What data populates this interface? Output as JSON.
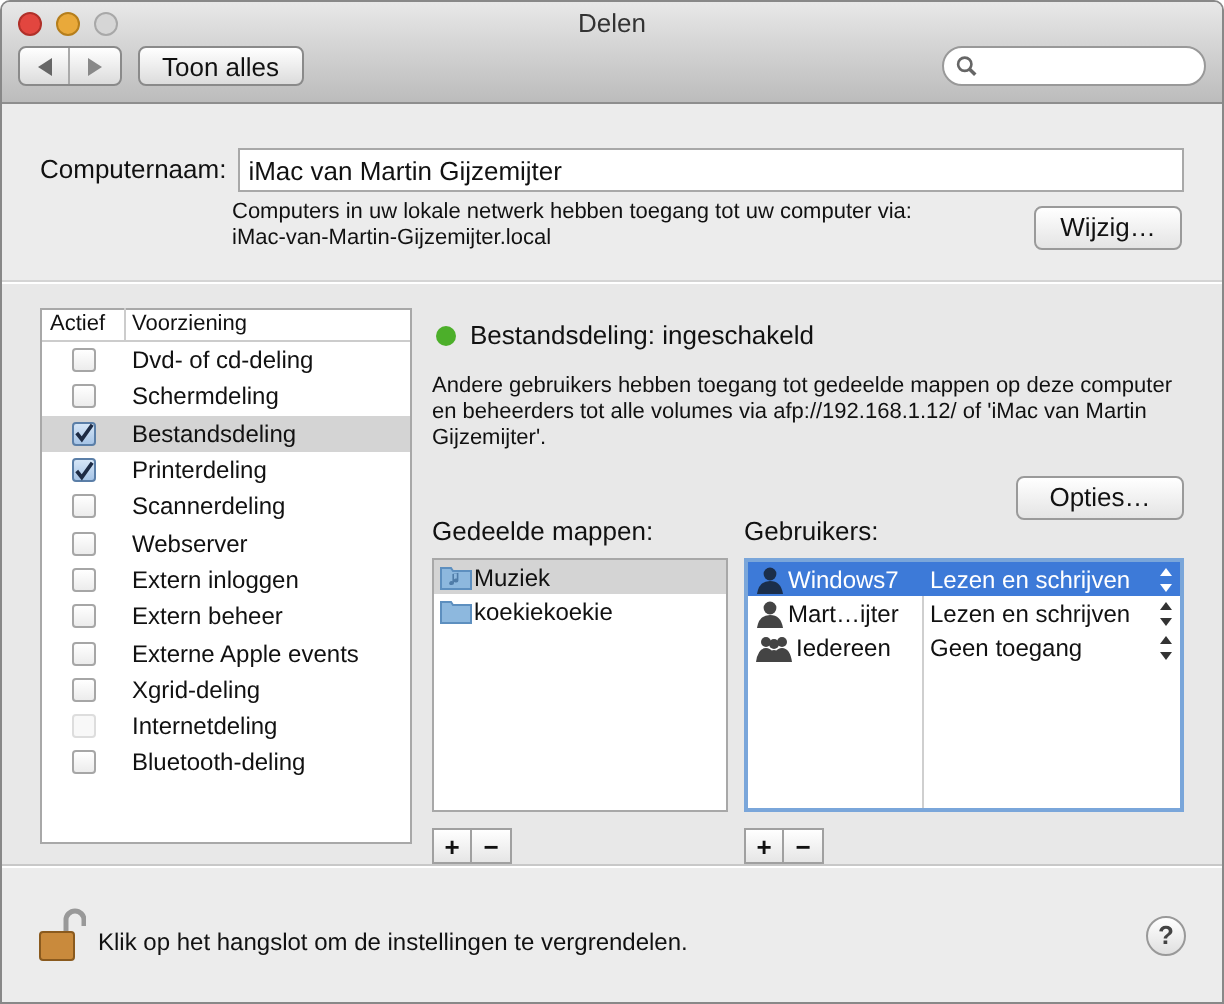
{
  "window": {
    "title": "Delen"
  },
  "toolbar": {
    "show_all": "Toon alles"
  },
  "computer_name": {
    "label": "Computernaam:",
    "value": "iMac van Martin Gijzemijter",
    "info": "Computers in uw lokale netwerk hebben toegang tot uw computer via:",
    "address": "iMac-van-Martin-Gijzemijter.local",
    "button": "Wijzig…"
  },
  "services": {
    "columns": [
      "Actief",
      "Voorziening"
    ],
    "items": [
      {
        "name": "Dvd- of cd-deling",
        "checked": false,
        "disabled": false,
        "selected": false
      },
      {
        "name": "Schermdeling",
        "checked": false,
        "disabled": false,
        "selected": false
      },
      {
        "name": "Bestandsdeling",
        "checked": true,
        "disabled": false,
        "selected": true
      },
      {
        "name": "Printerdeling",
        "checked": true,
        "disabled": false,
        "selected": false
      },
      {
        "name": "Scannerdeling",
        "checked": false,
        "disabled": false,
        "selected": false
      },
      {
        "name": "Webserver",
        "checked": false,
        "disabled": false,
        "selected": false
      },
      {
        "name": "Extern inloggen",
        "checked": false,
        "disabled": false,
        "selected": false
      },
      {
        "name": "Extern beheer",
        "checked": false,
        "disabled": false,
        "selected": false
      },
      {
        "name": "Externe Apple events",
        "checked": false,
        "disabled": false,
        "selected": false
      },
      {
        "name": "Xgrid-deling",
        "checked": false,
        "disabled": false,
        "selected": false
      },
      {
        "name": "Internetdeling",
        "checked": false,
        "disabled": true,
        "selected": false
      },
      {
        "name": "Bluetooth-deling",
        "checked": false,
        "disabled": false,
        "selected": false
      }
    ]
  },
  "status": {
    "text": "Bestandsdeling: ingeschakeld",
    "color": "#4caf2a"
  },
  "description": "Andere gebruikers hebben toegang tot gedeelde mappen op deze computer en beheerders tot alle volumes via afp://192.168.1.12/ of 'iMac van Martin Gijzemijter'.",
  "options_button": "Opties…",
  "shared_folders": {
    "label": "Gedeelde mappen:",
    "items": [
      {
        "name": "Muziek",
        "kind": "music",
        "selected": true
      },
      {
        "name": "koekiekoekie",
        "kind": "plain",
        "selected": false
      }
    ],
    "add": "+",
    "remove": "−"
  },
  "users": {
    "label": "Gebruikers:",
    "items": [
      {
        "name": "Windows7",
        "kind": "user",
        "access": "Lezen en schrijven",
        "selected": true
      },
      {
        "name": "Mart…ijter",
        "kind": "user",
        "access": "Lezen en schrijven",
        "selected": false
      },
      {
        "name": "Iedereen",
        "kind": "group",
        "access": "Geen toegang",
        "selected": false
      }
    ],
    "add": "+",
    "remove": "−"
  },
  "footer": {
    "lock_text": "Klik op het hangslot om de instellingen te vergrendelen.",
    "help": "?"
  }
}
